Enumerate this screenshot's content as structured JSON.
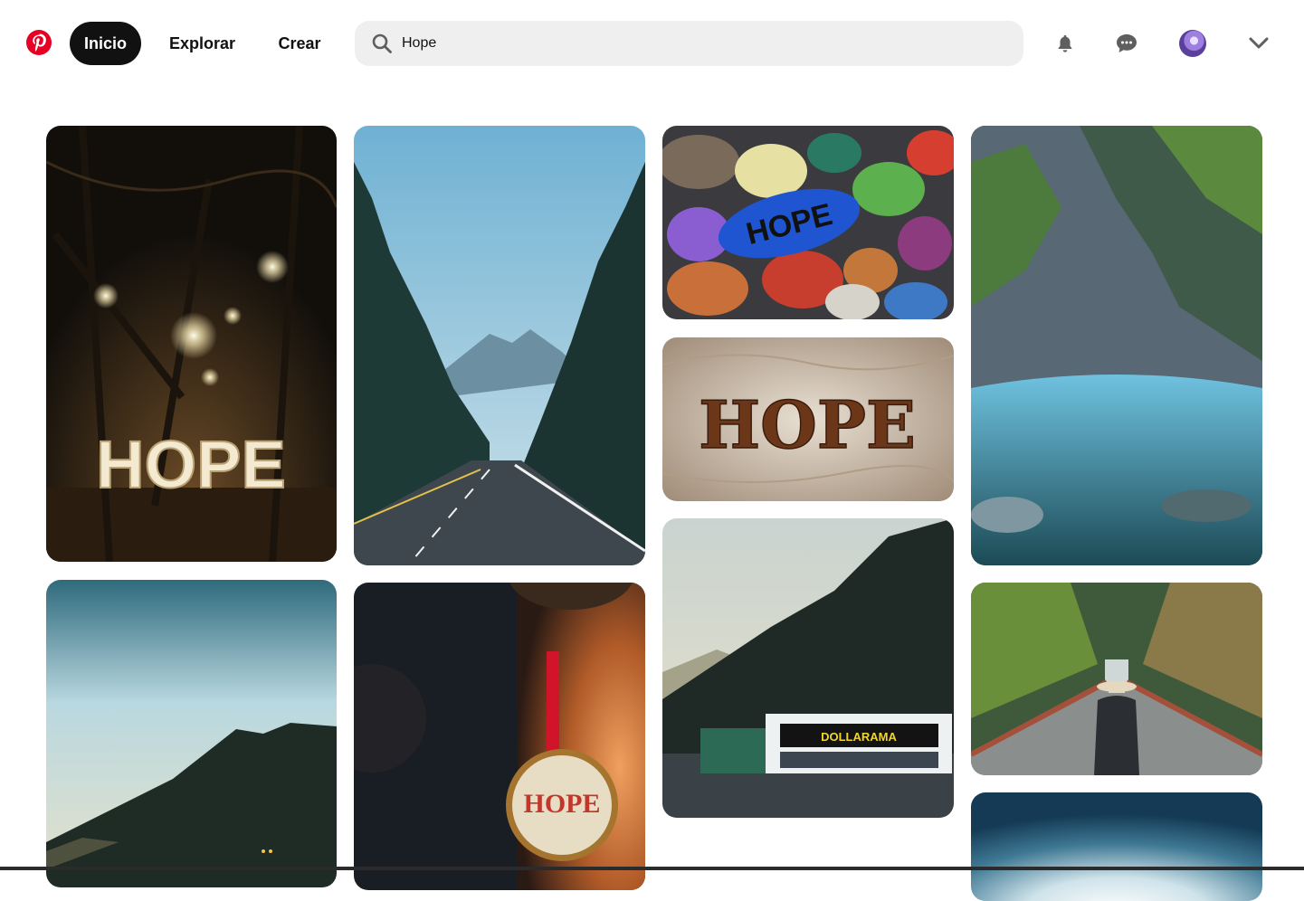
{
  "nav": {
    "home_label": "Inicio",
    "explore_label": "Explorar",
    "create_label": "Crear"
  },
  "search": {
    "value": "Hope"
  },
  "icons": {
    "logo": "pinterest-logo",
    "search": "search-icon",
    "notifications": "bell-icon",
    "messages": "chat-bubble-icon",
    "account_menu": "chevron-down-icon"
  },
  "colors": {
    "brand": "#e60023",
    "active_nav_bg": "#111111",
    "search_bg": "#efefef"
  },
  "pins": [
    {
      "id": "hope-marquee-lights",
      "text": "HOPE"
    },
    {
      "id": "mountain-highway"
    },
    {
      "id": "painted-rocks-hope",
      "text": "HOPE"
    },
    {
      "id": "canyon-river"
    },
    {
      "id": "hope-carved-wood",
      "text": "HOPE"
    },
    {
      "id": "mountain-slope-sky"
    },
    {
      "id": "hope-cross-stitch-ornament",
      "text": "HOPE"
    },
    {
      "id": "dollarama-mountain",
      "text": "DOLLARAMA"
    },
    {
      "id": "bridge-canyon-hat"
    },
    {
      "id": "blue-sky-glow"
    }
  ]
}
